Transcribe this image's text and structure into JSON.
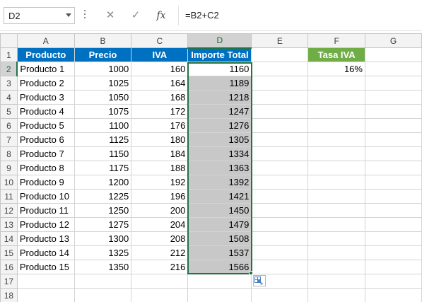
{
  "formula_bar": {
    "name_box": "D2",
    "cancel_icon": "✕",
    "enter_icon": "✓",
    "fx_label": "fx",
    "formula": "=B2+C2"
  },
  "columns": [
    "A",
    "B",
    "C",
    "D",
    "E",
    "F",
    "G"
  ],
  "selected_column": "D",
  "header_row": {
    "row": "1",
    "A": "Producto",
    "B": "Precio",
    "C": "IVA",
    "D": "Importe Total",
    "F": "Tasa IVA"
  },
  "rows": [
    {
      "row": "2",
      "A": "Producto 1",
      "B": "1000",
      "C": "160",
      "D": "1160",
      "F": "16%"
    },
    {
      "row": "3",
      "A": "Producto 2",
      "B": "1025",
      "C": "164",
      "D": "1189"
    },
    {
      "row": "4",
      "A": "Producto 3",
      "B": "1050",
      "C": "168",
      "D": "1218"
    },
    {
      "row": "5",
      "A": "Producto 4",
      "B": "1075",
      "C": "172",
      "D": "1247"
    },
    {
      "row": "6",
      "A": "Producto 5",
      "B": "1100",
      "C": "176",
      "D": "1276"
    },
    {
      "row": "7",
      "A": "Producto 6",
      "B": "1125",
      "C": "180",
      "D": "1305"
    },
    {
      "row": "8",
      "A": "Producto 7",
      "B": "1150",
      "C": "184",
      "D": "1334"
    },
    {
      "row": "9",
      "A": "Producto 8",
      "B": "1175",
      "C": "188",
      "D": "1363"
    },
    {
      "row": "10",
      "A": "Producto 9",
      "B": "1200",
      "C": "192",
      "D": "1392"
    },
    {
      "row": "11",
      "A": "Producto 10",
      "B": "1225",
      "C": "196",
      "D": "1421"
    },
    {
      "row": "12",
      "A": "Producto 11",
      "B": "1250",
      "C": "200",
      "D": "1450"
    },
    {
      "row": "13",
      "A": "Producto 12",
      "B": "1275",
      "C": "204",
      "D": "1479"
    },
    {
      "row": "14",
      "A": "Producto 13",
      "B": "1300",
      "C": "208",
      "D": "1508"
    },
    {
      "row": "15",
      "A": "Producto 14",
      "B": "1325",
      "C": "212",
      "D": "1537"
    },
    {
      "row": "16",
      "A": "Producto 15",
      "B": "1350",
      "C": "216",
      "D": "1566"
    }
  ],
  "empty_rows": [
    "17",
    "18"
  ],
  "colors": {
    "header_blue": "#0070c0",
    "header_green": "#70ad47",
    "selection_green": "#217346",
    "shaded_cells": "#c8c8c8"
  },
  "icons": {
    "paste_options": "paste-options-icon"
  }
}
